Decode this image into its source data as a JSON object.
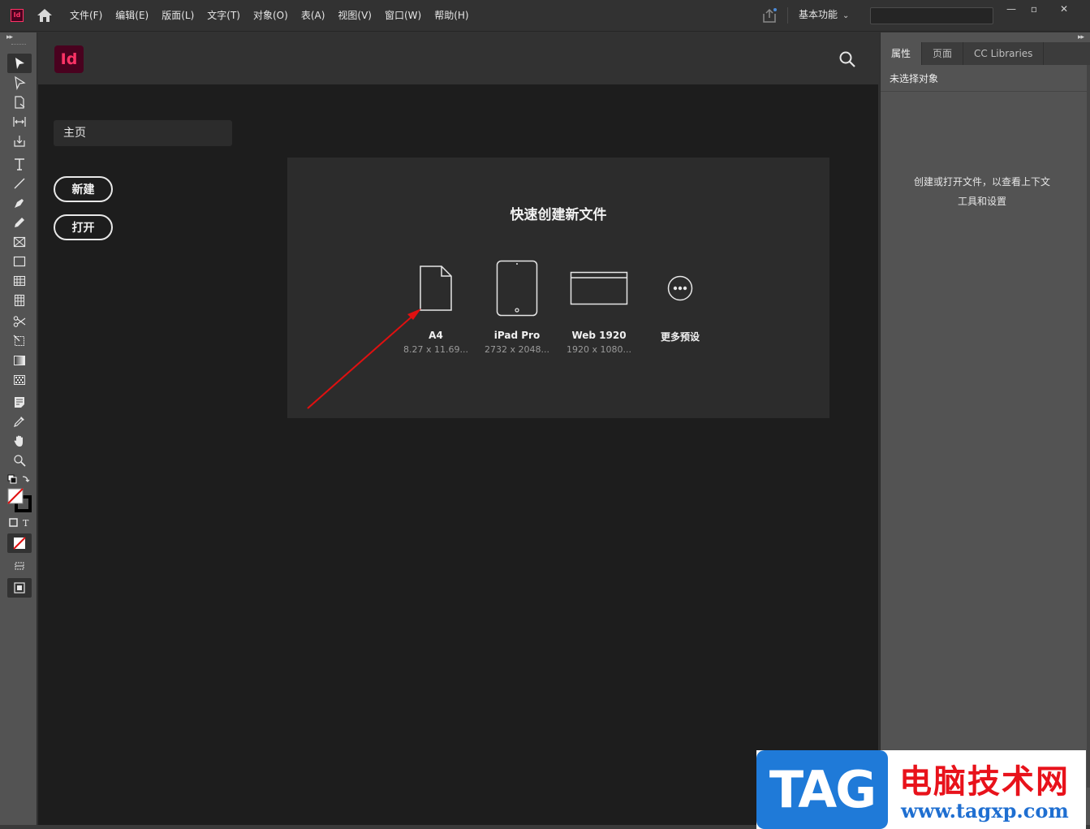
{
  "app": {
    "logo_text": "Id",
    "menu": [
      "文件(F)",
      "编辑(E)",
      "版面(L)",
      "文字(T)",
      "对象(O)",
      "表(A)",
      "视图(V)",
      "窗口(W)",
      "帮助(H)"
    ],
    "workspace_label": "基本功能",
    "search_value": "",
    "window_controls": {
      "minimize": "—",
      "restore": "▫",
      "close": "✕"
    }
  },
  "home": {
    "logo_text": "Id",
    "nav_home": "主页",
    "new_button": "新建",
    "open_button": "打开",
    "quick_title": "快速创建新文件",
    "presets": [
      {
        "name": "A4",
        "size": "8.27 x 11.69...",
        "icon": "document-icon"
      },
      {
        "name": "iPad Pro",
        "size": "2732 x 2048...",
        "icon": "tablet-icon"
      },
      {
        "name": "Web 1920",
        "size": "1920 x 1080...",
        "icon": "browser-window-icon"
      },
      {
        "name": "更多预设",
        "size": "",
        "icon": "more-icon"
      }
    ]
  },
  "right_panel": {
    "tabs": [
      "属性",
      "页面",
      "CC Libraries"
    ],
    "active_tab": "属性",
    "no_selection": "未选择对象",
    "hint_line1": "创建或打开文件，以查看上下文",
    "hint_line2": "工具和设置"
  },
  "annotation": {
    "color": "#e01010"
  },
  "watermark": {
    "tag": "TAG",
    "cn": "电脑技术网",
    "url": "www.tagxp.com",
    "colors": {
      "blue": "#1f7ad8",
      "red": "#e8121b"
    }
  },
  "colors": {
    "brand_bg": "#49021f",
    "brand_fg": "#ff3366"
  }
}
